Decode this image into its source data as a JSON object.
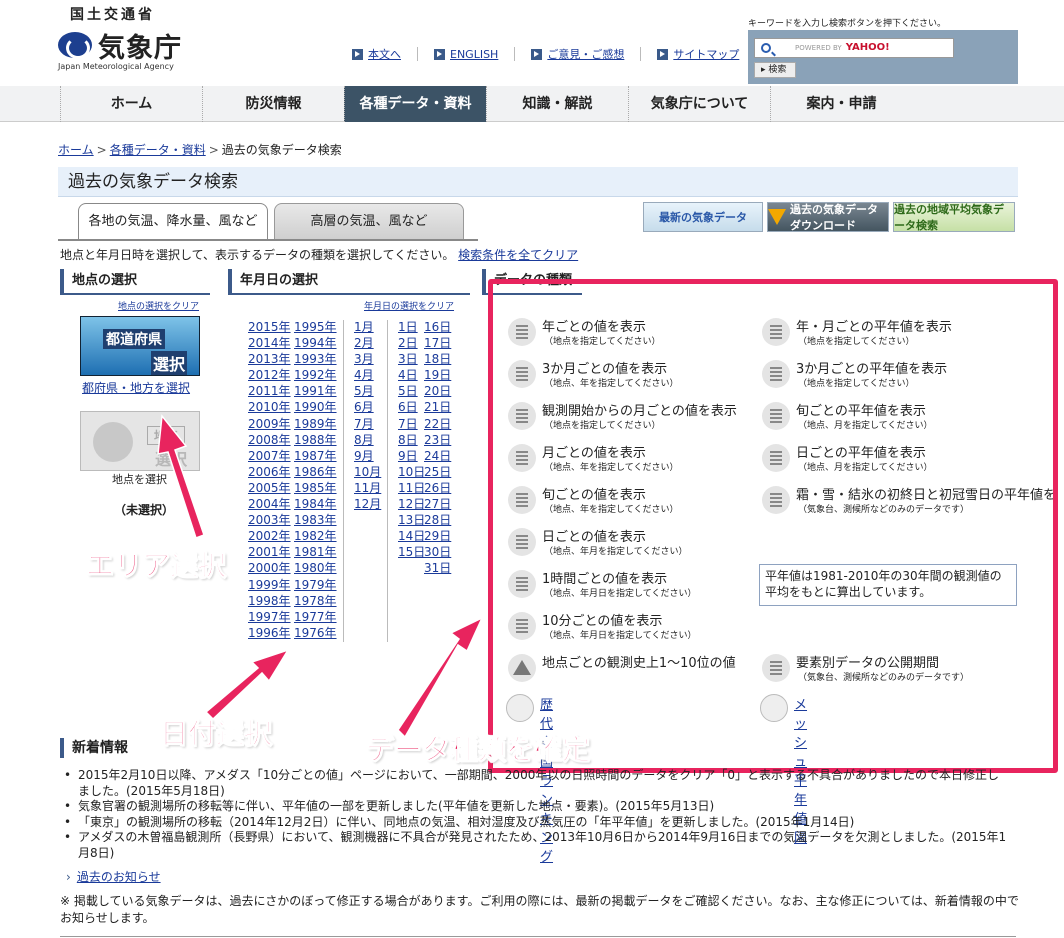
{
  "header": {
    "ministry": "国土交通省",
    "logo": "気象庁",
    "logo_sub": "Japan Meteorological Agency",
    "top_links": [
      "本文へ",
      "ENGLISH",
      "ご意見・ご感想",
      "サイトマップ"
    ],
    "search_note": "キーワードを入力し検索ボタンを押下ください。",
    "search_placeholder": "POWERED BY",
    "search_brand": "YAHOO!",
    "search_button": "検索"
  },
  "nav": [
    "ホーム",
    "防災情報",
    "各種データ・資料",
    "知識・解説",
    "気象庁について",
    "案内・申請"
  ],
  "breadcrumb": [
    "ホーム",
    "各種データ・資料",
    "過去の気象データ検索"
  ],
  "page_title": "過去の気象データ検索",
  "tabs": [
    "各地の気温、降水量、風など",
    "高層の気温、風など"
  ],
  "banners": [
    "最新の気象データ",
    "過去の気象データ ダウンロード",
    "過去の地域平均気象データ検索"
  ],
  "intro": "地点と年月日時を選択して、表示するデータの種類を選択してください。",
  "intro_link": "検索条件を全てクリア",
  "sections": {
    "point": "地点の選択",
    "date": "年月日の選択",
    "type": "データの種類"
  },
  "point": {
    "clear": "地点の選択をクリア",
    "pref_label1": "都道府県",
    "pref_label2": "選択",
    "pref_link": "都府県・地方を選択",
    "point_label1": "地点",
    "point_label2": "選択",
    "point_caption": "地点を選択",
    "unselected": "（未選択）"
  },
  "date": {
    "clear": "年月日の選択をクリア",
    "years1": [
      "2015年",
      "2014年",
      "2013年",
      "2012年",
      "2011年",
      "2010年",
      "2009年",
      "2008年",
      "2007年",
      "2006年",
      "2005年",
      "2004年",
      "2003年",
      "2002年",
      "2001年",
      "2000年",
      "1999年",
      "1998年",
      "1997年",
      "1996年"
    ],
    "years2": [
      "1995年",
      "1994年",
      "1993年",
      "1992年",
      "1991年",
      "1990年",
      "1989年",
      "1988年",
      "1987年",
      "1986年",
      "1985年",
      "1984年",
      "1983年",
      "1982年",
      "1981年",
      "1980年",
      "1979年",
      "1978年",
      "1977年",
      "1976年"
    ],
    "months": [
      "1月",
      "2月",
      "3月",
      "4月",
      "5月",
      "6月",
      "7月",
      "8月",
      "9月",
      "10月",
      "11月",
      "12月"
    ],
    "days1": [
      "1日",
      "2日",
      "3日",
      "4日",
      "5日",
      "6日",
      "7日",
      "8日",
      "9日",
      "10日",
      "11日",
      "12日",
      "13日",
      "14日",
      "15日"
    ],
    "days2": [
      "16日",
      "17日",
      "18日",
      "19日",
      "20日",
      "21日",
      "22日",
      "23日",
      "24日",
      "25日",
      "26日",
      "27日",
      "28日",
      "29日",
      "30日",
      "31日"
    ]
  },
  "types_left": [
    {
      "label": "年ごとの値を表示",
      "sub": "（地点を指定してください）"
    },
    {
      "label": "3か月ごとの値を表示",
      "sub": "（地点、年を指定してください）"
    },
    {
      "label": "観測開始からの月ごとの値を表示",
      "sub": "（地点を指定してください）"
    },
    {
      "label": "月ごとの値を表示",
      "sub": "（地点、年を指定してください）"
    },
    {
      "label": "旬ごとの値を表示",
      "sub": "（地点、年を指定してください）"
    },
    {
      "label": "日ごとの値を表示",
      "sub": "（地点、年月を指定してください）"
    },
    {
      "label": "1時間ごとの値を表示",
      "sub": "（地点、年月日を指定してください）"
    },
    {
      "label": "10分ごとの値を表示",
      "sub": "（地点、年月日を指定してください）"
    },
    {
      "label": "地点ごとの観測史上1～10位の値",
      "sub": ""
    }
  ],
  "types_right": [
    {
      "label": "年・月ごとの平年値を表示",
      "sub": "（地点を指定してください）"
    },
    {
      "label": "3か月ごとの平年値を表示",
      "sub": "（地点を指定してください）"
    },
    {
      "label": "旬ごとの平年値を表示",
      "sub": "（地点、月を指定してください）"
    },
    {
      "label": "日ごとの平年値を表示",
      "sub": "（地点、月を指定してください）"
    },
    {
      "label": "霜・雪・結氷の初終日と初冠雪日の平年値を",
      "sub": "（気象台、測候所などのみのデータです）"
    }
  ],
  "type_extra": {
    "label": "要素別データの公開期間",
    "sub": "（気象台、測候所などのみのデータです）"
  },
  "note": "平年値は1981-2010年の30年間の観測値の平均をもとに算出しています。",
  "links": [
    "歴代全国ランキング",
    "メッシュ平年値図"
  ],
  "annotations": [
    "エリア選択",
    "日付選択",
    "データ種類を確定"
  ],
  "news": {
    "title": "新着情報",
    "items": [
      "2015年2月10日以降、アメダス「10分ごとの値」ページにおいて、一部期間、2000年以の日照時間のデータをクリア「0」と表示する不具合がありましたので本日修正しました。(2015年5月18日)",
      "気象官署の観測場所の移転等に伴い、平年値の一部を更新しました(平年値を更新した地点・要素)。(2015年5月13日)",
      "「東京」の観測場所の移転（2014年12月2日）に伴い、同地点の気温、相対湿度及び蒸気圧の「年平年値」を更新しました。(2015年1月14日)",
      "アメダスの木曽福島観測所（長野県）において、観測機器に不具合が発見されたため、2013年10月6日から2014年9月16日までの気温データを欠測としました。(2015年1月8日)"
    ]
  },
  "past_link": "過去のお知らせ",
  "footer": "※ 掲載している気象データは、過去にさかのぼって修正する場合があります。ご利用の際には、最新の掲載データをご確認ください。なお、主な修正については、新着情報の中でお知らせします。"
}
